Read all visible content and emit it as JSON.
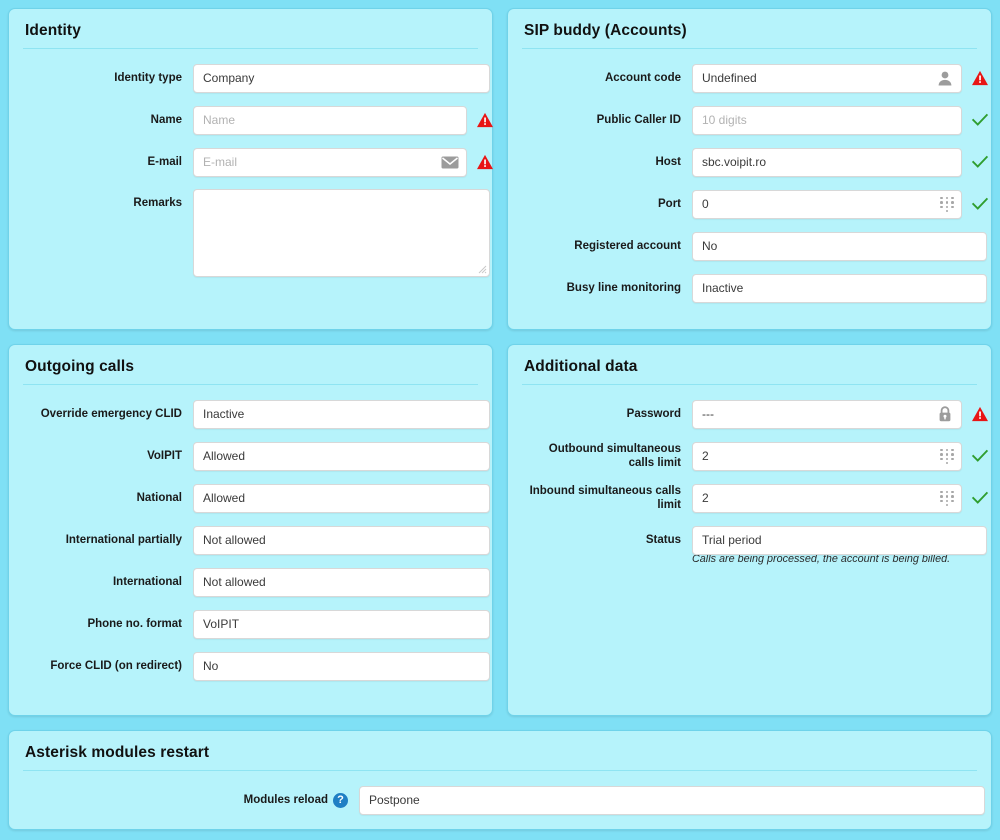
{
  "colors": {
    "page_bg": "#7fe0f5",
    "panel_bg": "#b6f3fb",
    "field_bg": "#ffffff",
    "warning": "#e81515",
    "ok": "#2f9e2f",
    "help": "#1f7fc4"
  },
  "panels": {
    "identity": {
      "title": "Identity",
      "fields": {
        "identity_type": {
          "label": "Identity type",
          "value": "Company",
          "icon": "hamburger-icon"
        },
        "name": {
          "label": "Name",
          "placeholder": "Name",
          "value": "",
          "status": "warning-icon"
        },
        "email": {
          "label": "E-mail",
          "placeholder": "E-mail",
          "value": "",
          "icon": "envelope-icon",
          "status": "warning-icon"
        },
        "remarks": {
          "label": "Remarks",
          "value": ""
        }
      }
    },
    "sip_buddy": {
      "title": "SIP buddy (Accounts)",
      "fields": {
        "account_code": {
          "label": "Account code",
          "value": "Undefined",
          "icon": "person-icon",
          "status": "warning-icon"
        },
        "public_caller_id": {
          "label": "Public Caller ID",
          "placeholder": "10 digits",
          "value": "",
          "status": "check-icon"
        },
        "host": {
          "label": "Host",
          "value": "sbc.voipit.ro",
          "status": "check-icon"
        },
        "port": {
          "label": "Port",
          "value": "0",
          "icon": "keypad-icon",
          "status": "check-icon"
        },
        "registered_account": {
          "label": "Registered account",
          "value": "No",
          "icon": "hamburger-icon"
        },
        "busy_line_monitoring": {
          "label": "Busy line monitoring",
          "value": "Inactive",
          "icon": "hamburger-icon"
        }
      }
    },
    "outgoing_calls": {
      "title": "Outgoing calls",
      "fields": {
        "override_emergency_clid": {
          "label": "Override emergency CLID",
          "value": "Inactive",
          "icon": "hamburger-icon"
        },
        "voipit": {
          "label": "VoIPIT",
          "value": "Allowed",
          "icon": "hamburger-icon"
        },
        "national": {
          "label": "National",
          "value": "Allowed",
          "icon": "hamburger-icon"
        },
        "international_partially": {
          "label": "International partially",
          "value": "Not allowed",
          "icon": "hamburger-icon"
        },
        "international": {
          "label": "International",
          "value": "Not allowed",
          "icon": "hamburger-icon"
        },
        "phone_no_format": {
          "label": "Phone no. format",
          "value": "VoIPIT",
          "icon": "hamburger-icon"
        },
        "force_clid_on_redirect": {
          "label": "Force CLID (on redirect)",
          "value": "No",
          "icon": "hamburger-icon"
        }
      }
    },
    "additional_data": {
      "title": "Additional data",
      "fields": {
        "password": {
          "label": "Password",
          "value": "---",
          "icon": "lock-icon",
          "status": "warning-icon"
        },
        "outbound_limit": {
          "label": "Outbound simultaneous calls limit",
          "value": "2",
          "icon": "keypad-icon",
          "status": "check-icon"
        },
        "inbound_limit": {
          "label": "Inbound simultaneous calls limit",
          "value": "2",
          "icon": "keypad-icon",
          "status": "check-icon"
        },
        "status": {
          "label": "Status",
          "value": "Trial period",
          "icon": "hamburger-icon",
          "hint": "Calls are being processed, the account is being billed."
        }
      }
    },
    "asterisk_modules_restart": {
      "title": "Asterisk modules restart",
      "fields": {
        "modules_reload": {
          "label": "Modules reload",
          "help": "?",
          "value": "Postpone",
          "icon": "hamburger-icon"
        }
      }
    }
  }
}
